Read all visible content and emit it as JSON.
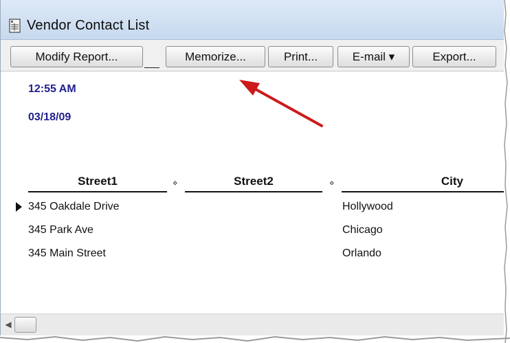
{
  "window": {
    "title": "Vendor Contact List"
  },
  "toolbar": {
    "modify_report": "Modify Report...",
    "memorize": "Memorize...",
    "print": "Print...",
    "email": "E-mail ▾",
    "export": "Export..."
  },
  "report_header": {
    "time": "12:55 AM",
    "date": "03/18/09"
  },
  "columns": {
    "street1": "Street1",
    "street2": "Street2",
    "city": "City",
    "sort_marker": "⋄"
  },
  "rows": [
    {
      "street1": "345 Oakdale Drive",
      "street2": "",
      "city": "Hollywood"
    },
    {
      "street1": "345 Park Ave",
      "street2": "",
      "city": "Chicago"
    },
    {
      "street1": "345 Main Street",
      "street2": "",
      "city": "Orlando"
    }
  ],
  "colors": {
    "header_text": "#1f1f8f",
    "annotation_arrow": "#cc1a1a",
    "titlebar": "#d3e2f4"
  },
  "icons": {
    "title_icon": "report-document-icon",
    "scroll_left": "chevron-left-icon"
  }
}
